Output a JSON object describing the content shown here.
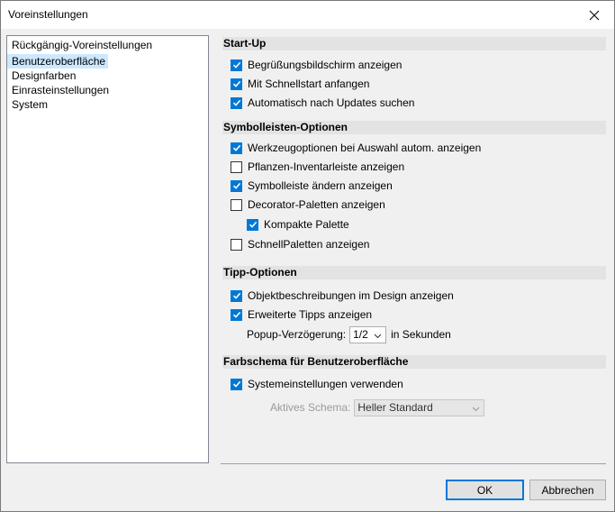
{
  "window": {
    "title": "Voreinstellungen"
  },
  "nav": {
    "items": [
      "Rückgängig-Voreinstellungen",
      "Benutzeroberfläche",
      "Designfarben",
      "Einrasteinstellungen",
      "System"
    ],
    "selected_index": 1
  },
  "sections": {
    "startup": {
      "title": "Start-Up",
      "options": [
        {
          "label": "Begrüßungsbildschirm anzeigen",
          "checked": true
        },
        {
          "label": "Mit Schnellstart anfangen",
          "checked": true
        },
        {
          "label": "Automatisch nach Updates suchen",
          "checked": true
        }
      ]
    },
    "toolbar": {
      "title": "Symbolleisten-Optionen",
      "options": [
        {
          "label": "Werkzeugoptionen bei Auswahl autom. anzeigen",
          "checked": true
        },
        {
          "label": "Pflanzen-Inventarleiste anzeigen",
          "checked": false
        },
        {
          "label": "Symbolleiste ändern anzeigen",
          "checked": true
        },
        {
          "label": "Decorator-Paletten anzeigen",
          "checked": false
        },
        {
          "label": "Kompakte Palette",
          "checked": true
        },
        {
          "label": "SchnellPaletten anzeigen",
          "checked": false
        }
      ]
    },
    "tips": {
      "title": "Tipp-Optionen",
      "options": [
        {
          "label": "Objektbeschreibungen im Design anzeigen",
          "checked": true
        },
        {
          "label": "Erweiterte Tipps anzeigen",
          "checked": true
        }
      ],
      "popup_label": "Popup-Verzögerung:",
      "popup_value": "1/2",
      "popup_suffix": "in Sekunden"
    },
    "colors": {
      "title": "Farbschema für Benutzeroberfläche",
      "options": [
        {
          "label": "Systemeinstellungen verwenden",
          "checked": true
        }
      ],
      "scheme_label": "Aktives Schema:",
      "scheme_value": "Heller Standard"
    }
  },
  "buttons": {
    "ok": "OK",
    "cancel": "Abbrechen"
  },
  "colors": {
    "accent": "#0078d7",
    "selection": "#cce8ff",
    "section_bg": "#e3e3e3"
  }
}
